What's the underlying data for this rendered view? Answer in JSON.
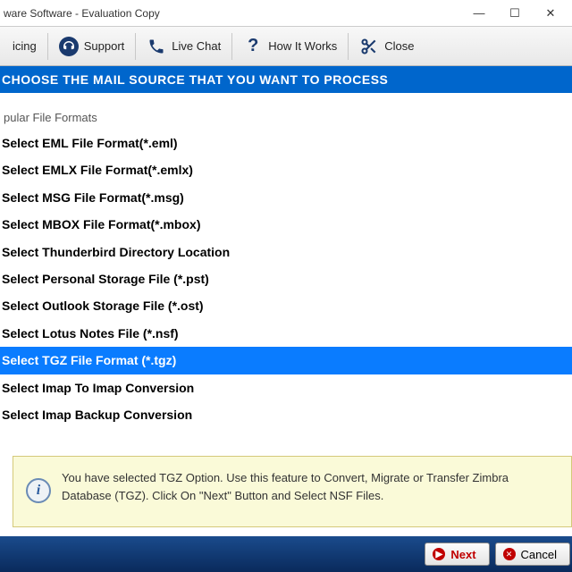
{
  "window": {
    "title": "ware Software - Evaluation Copy"
  },
  "toolbar": {
    "pricing": "icing",
    "support": "Support",
    "livechat": "Live Chat",
    "howitworks": "How It Works",
    "close": "Close"
  },
  "banner": "CHOOSE THE MAIL SOURCE THAT YOU WANT TO PROCESS",
  "section_title": "pular File Formats",
  "formats": {
    "f0": "Select EML File Format(*.eml)",
    "f1": "Select EMLX File Format(*.emlx)",
    "f2": "Select MSG File Format(*.msg)",
    "f3": "Select MBOX File Format(*.mbox)",
    "f4": "Select Thunderbird Directory Location",
    "f5": "Select Personal Storage File (*.pst)",
    "f6": "Select Outlook Storage File (*.ost)",
    "f7": "Select Lotus Notes File (*.nsf)",
    "f8": "Select TGZ File Format (*.tgz)",
    "f9": "Select Imap To Imap Conversion",
    "f10": "Select Imap Backup Conversion"
  },
  "selected_index": 8,
  "info": "You have selected TGZ Option. Use this feature to Convert, Migrate or Transfer Zimbra Database (TGZ). Click On \"Next\" Button and Select NSF Files.",
  "buttons": {
    "next": "Next",
    "cancel": "Cancel"
  }
}
